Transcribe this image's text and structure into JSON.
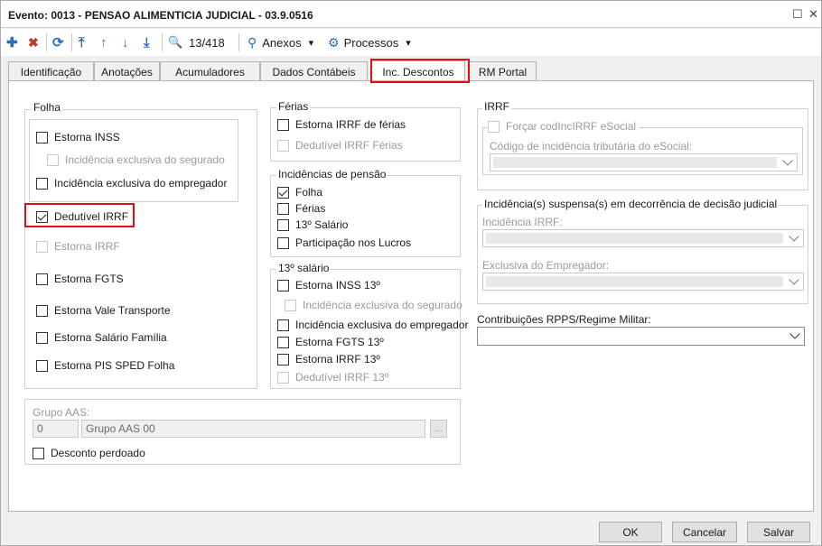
{
  "window": {
    "title": "Evento: 0013 - PENSAO ALIMENTICIA JUDICIAL - 03.9.0516",
    "restore_glyph": "☐",
    "close_glyph": "✕"
  },
  "toolbar": {
    "add": "✚",
    "delete": "✖",
    "refresh": "⟳",
    "first": "⤒",
    "prev": "↑",
    "next": "↓",
    "last": "⤓",
    "search": "🔍",
    "record_position": "13/418",
    "anexos_label": "Anexos",
    "processos_label": "Processos",
    "dropdown_glyph": "▾"
  },
  "tabs": [
    "Identificação",
    "Anotações",
    "Acumuladores",
    "Dados Contábeis",
    "Inc. Descontos",
    "RM Portal"
  ],
  "folha": {
    "title": "Folha",
    "estorna_inss": "Estorna INSS",
    "incidencia_segurado": "Incidência exclusiva do segurado",
    "incidencia_empregador": "Incidência exclusiva do empregador",
    "dedutivel_irrf": "Dedutível IRRF",
    "estorna_irrf": "Estorna IRRF",
    "estorna_fgts": "Estorna FGTS",
    "estorna_vale": "Estorna Vale Transporte",
    "estorna_salario_familia": "Estorna Salário Família",
    "estorna_pis": "Estorna PIS SPED Folha"
  },
  "ferias": {
    "title": "Férias",
    "estorna_irrf_ferias": "Estorna IRRF de férias",
    "dedutivel_irrf_ferias": "Dedutível IRRF Férias"
  },
  "pensao": {
    "title": "Incidências de pensão",
    "folha": "Folha",
    "ferias": "Férias",
    "decimo": "13º Salário",
    "participacao": "Participação nos Lucros"
  },
  "decimo": {
    "title": "13º salário",
    "estorna_inss": "Estorna INSS 13º",
    "incidencia_segurado": "Incidência exclusiva do segurado",
    "incidencia_empregador": "Incidência exclusiva do empregador",
    "estorna_fgts": "Estorna FGTS 13º",
    "estorna_irrf": "Estorna IRRF 13º",
    "dedutivel_irrf": "Dedutível IRRF 13º"
  },
  "irrf": {
    "title": "IRRF",
    "forcar": "Forçar codIncIRRF eSocial",
    "codigo_label": "Código de incidência tributária do eSocial:"
  },
  "suspensa": {
    "title": "Incidência(s) suspensa(s) em decorrência de decisão judicial",
    "irrf_label": "Incidência IRRF:",
    "empregador_label": "Exclusiva do Empregador:"
  },
  "contribuicoes": {
    "label": "Contribuições RPPS/Regime Militar:"
  },
  "grupo_aas": {
    "label": "Grupo AAS:",
    "code": "0",
    "name": "Grupo AAS 00",
    "browse": "...",
    "desconto_perdoado": "Desconto perdoado"
  },
  "footer": {
    "ok": "OK",
    "cancel": "Cancelar",
    "save": "Salvar"
  }
}
